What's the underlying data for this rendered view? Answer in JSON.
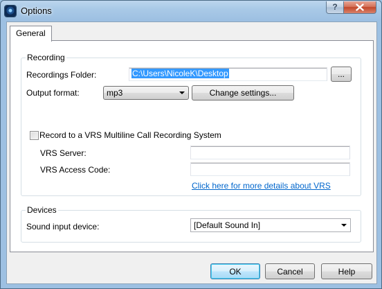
{
  "window": {
    "title": "Options",
    "help_label": "?",
    "close_label": "X",
    "icon": "app-icon"
  },
  "tabs": [
    {
      "label": "General",
      "selected": true
    }
  ],
  "recording": {
    "group_title": "Recording",
    "folder_label": "Recordings Folder:",
    "folder_value": "C:\\Users\\NicoleK\\Desktop",
    "browse_label": "...",
    "format_label": "Output format:",
    "format_value": "mp3",
    "change_settings_label": "Change settings...",
    "vrs_checkbox_label": "Record to a VRS Multiline Call Recording System",
    "vrs_checked": false,
    "vrs_server_label": "VRS Server:",
    "vrs_server_value": "",
    "vrs_code_label": "VRS Access Code:",
    "vrs_code_value": "",
    "vrs_link": "Click here for more details about VRS"
  },
  "devices": {
    "group_title": "Devices",
    "sound_input_label": "Sound input device:",
    "sound_input_value": "[Default Sound In]"
  },
  "footer": {
    "ok_label": "OK",
    "cancel_label": "Cancel",
    "help_label": "Help"
  },
  "colors": {
    "accent": "#3c7fb1",
    "link": "#0066cc",
    "selection": "#3399ff"
  }
}
